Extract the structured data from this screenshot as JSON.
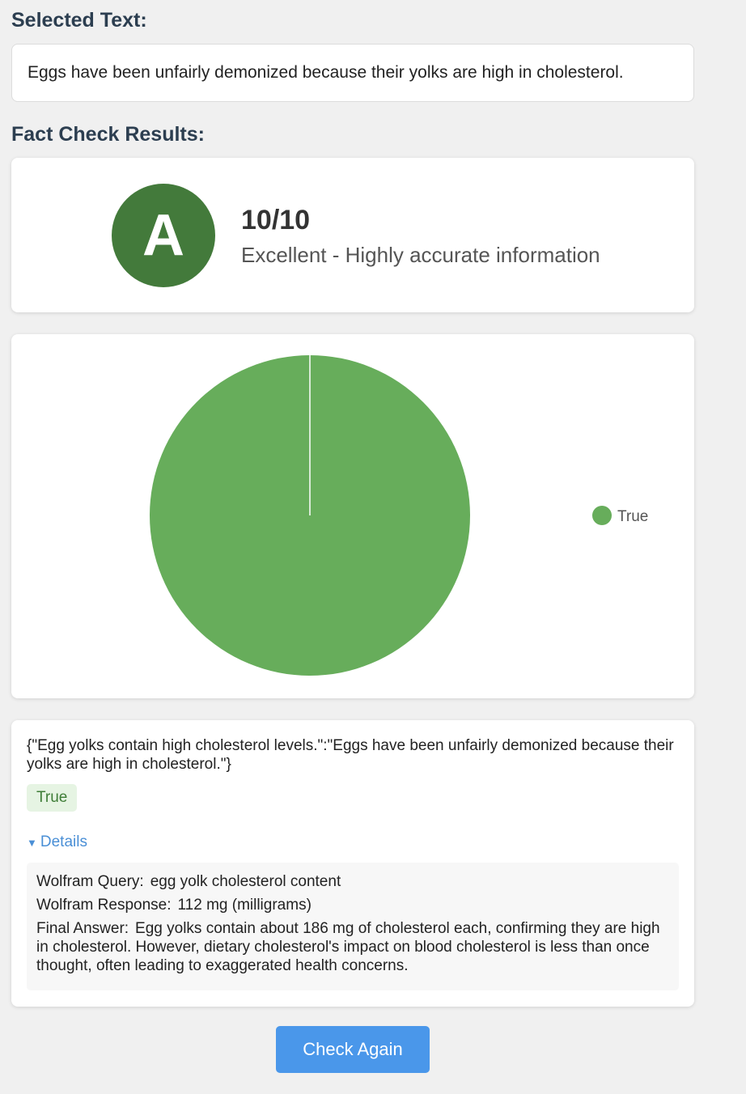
{
  "selected": {
    "heading": "Selected Text:",
    "text": "Eggs have been unfairly demonized because their yolks are high in cholesterol."
  },
  "results": {
    "heading": "Fact Check Results:",
    "grade": "A",
    "score": "10/10",
    "description": "Excellent - Highly accurate information",
    "grade_color": "#437a3b"
  },
  "chart_data": {
    "type": "pie",
    "labels": [
      "True"
    ],
    "values": [
      1
    ],
    "colors": [
      "#67ad5b"
    ],
    "legend_position": "right"
  },
  "claim": {
    "text": "{\"Egg yolks contain high cholesterol levels.\":\"Eggs have been unfairly demonized because their yolks are high in cholesterol.\"}",
    "verdict": "True",
    "details_label": "Details",
    "details_icon": "triangle-down-icon",
    "wolfram_query_label": "Wolfram Query:",
    "wolfram_query": "egg yolk cholesterol content",
    "wolfram_response_label": "Wolfram Response:",
    "wolfram_response": "112 mg (milligrams)",
    "final_answer_label": "Final Answer:",
    "final_answer": "Egg yolks contain about 186 mg of cholesterol each, confirming they are high in cholesterol. However, dietary cholesterol's impact on blood cholesterol is less than once thought, often leading to exaggerated health concerns."
  },
  "actions": {
    "check_again": "Check Again",
    "accent": "#4a97ea"
  }
}
